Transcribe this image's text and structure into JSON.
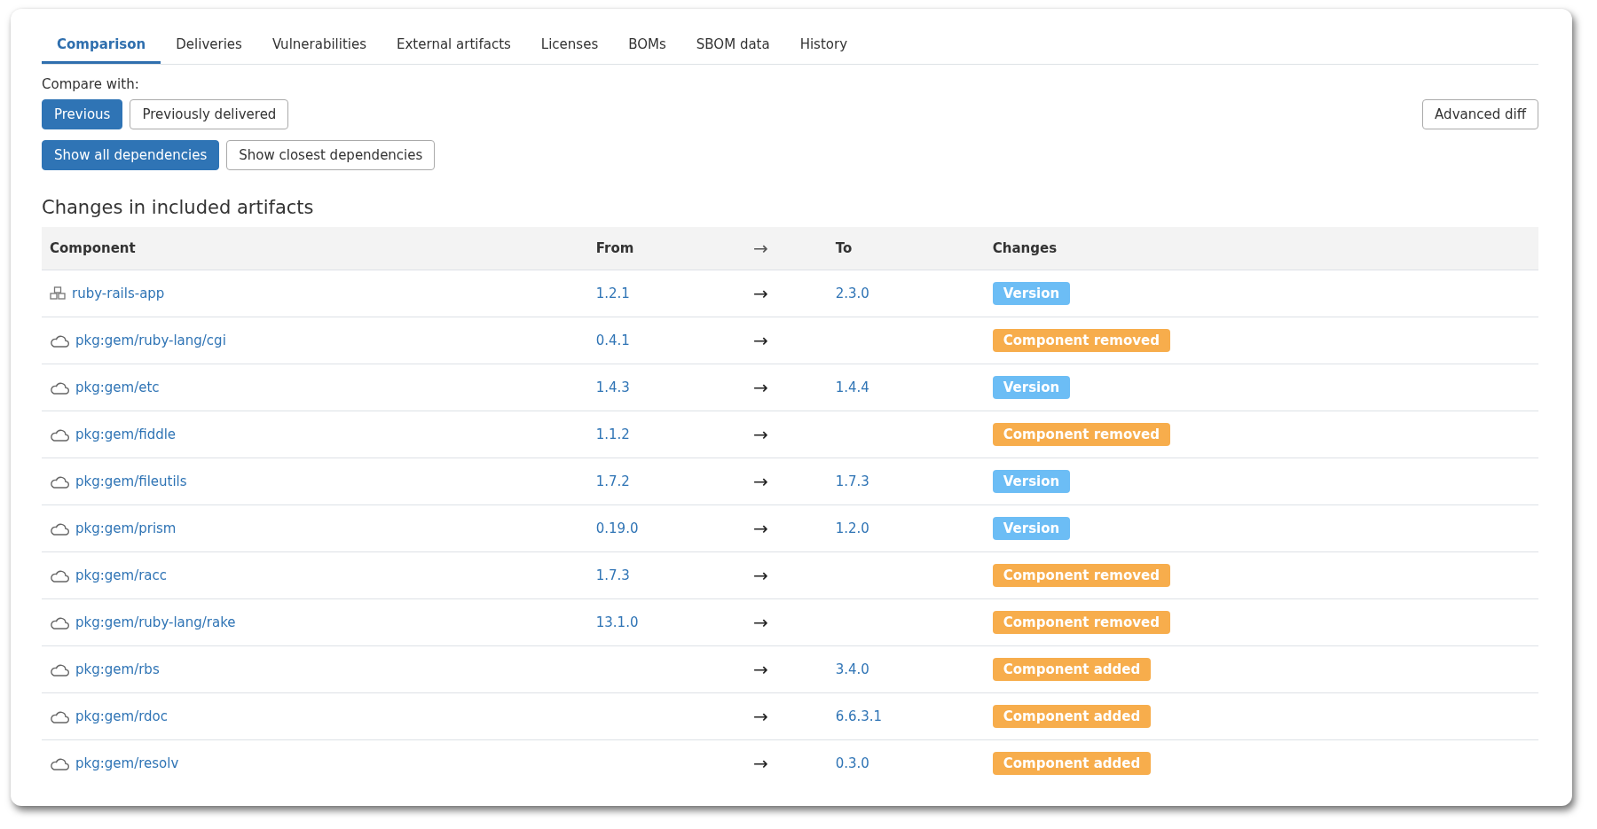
{
  "tabs": [
    {
      "label": "Comparison",
      "selected": true
    },
    {
      "label": "Deliveries",
      "selected": false
    },
    {
      "label": "Vulnerabilities",
      "selected": false
    },
    {
      "label": "External artifacts",
      "selected": false
    },
    {
      "label": "Licenses",
      "selected": false
    },
    {
      "label": "BOMs",
      "selected": false
    },
    {
      "label": "SBOM data",
      "selected": false
    },
    {
      "label": "History",
      "selected": false
    }
  ],
  "compare_label": "Compare with:",
  "compare_options": [
    {
      "label": "Previous",
      "selected": true
    },
    {
      "label": "Previously delivered",
      "selected": false
    }
  ],
  "advanced_button": "Advanced diff",
  "dependency_options": [
    {
      "label": "Show all dependencies",
      "selected": true
    },
    {
      "label": "Show closest dependencies",
      "selected": false
    }
  ],
  "section_title": "Changes in included artifacts",
  "table": {
    "columns": [
      "Component",
      "From",
      "→",
      "To",
      "Changes"
    ],
    "rows": [
      {
        "kind": "application",
        "component": "ruby-rails-app",
        "from": "1.2.1",
        "arrow": "→",
        "to": "2.3.0",
        "change": {
          "label": "Version",
          "kind": "version"
        }
      },
      {
        "kind": "package",
        "component": "pkg:gem/ruby-lang/cgi",
        "from": "0.4.1",
        "arrow": "→",
        "change": {
          "label": "Component removed",
          "kind": "removed"
        }
      },
      {
        "kind": "package",
        "component": "pkg:gem/etc",
        "from": "1.4.3",
        "arrow": "→",
        "to": "1.4.4",
        "change": {
          "label": "Version",
          "kind": "version"
        }
      },
      {
        "kind": "package",
        "component": "pkg:gem/fiddle",
        "from": "1.1.2",
        "arrow": "→",
        "change": {
          "label": "Component removed",
          "kind": "removed"
        }
      },
      {
        "kind": "package",
        "component": "pkg:gem/fileutils",
        "from": "1.7.2",
        "arrow": "→",
        "to": "1.7.3",
        "change": {
          "label": "Version",
          "kind": "version"
        }
      },
      {
        "kind": "package",
        "component": "pkg:gem/prism",
        "from": "0.19.0",
        "arrow": "→",
        "to": "1.2.0",
        "change": {
          "label": "Version",
          "kind": "version"
        }
      },
      {
        "kind": "package",
        "component": "pkg:gem/racc",
        "from": "1.7.3",
        "arrow": "→",
        "change": {
          "label": "Component removed",
          "kind": "removed"
        }
      },
      {
        "kind": "package",
        "component": "pkg:gem/ruby-lang/rake",
        "from": "13.1.0",
        "arrow": "→",
        "change": {
          "label": "Component removed",
          "kind": "removed"
        }
      },
      {
        "kind": "package",
        "component": "pkg:gem/rbs",
        "arrow": "→",
        "to": "3.4.0",
        "change": {
          "label": "Component added",
          "kind": "added"
        }
      },
      {
        "kind": "package",
        "component": "pkg:gem/rdoc",
        "arrow": "→",
        "to": "6.6.3.1",
        "change": {
          "label": "Component added",
          "kind": "added"
        }
      },
      {
        "kind": "package",
        "component": "pkg:gem/resolv",
        "arrow": "→",
        "to": "0.3.0",
        "change": {
          "label": "Component added",
          "kind": "added"
        }
      }
    ]
  }
}
